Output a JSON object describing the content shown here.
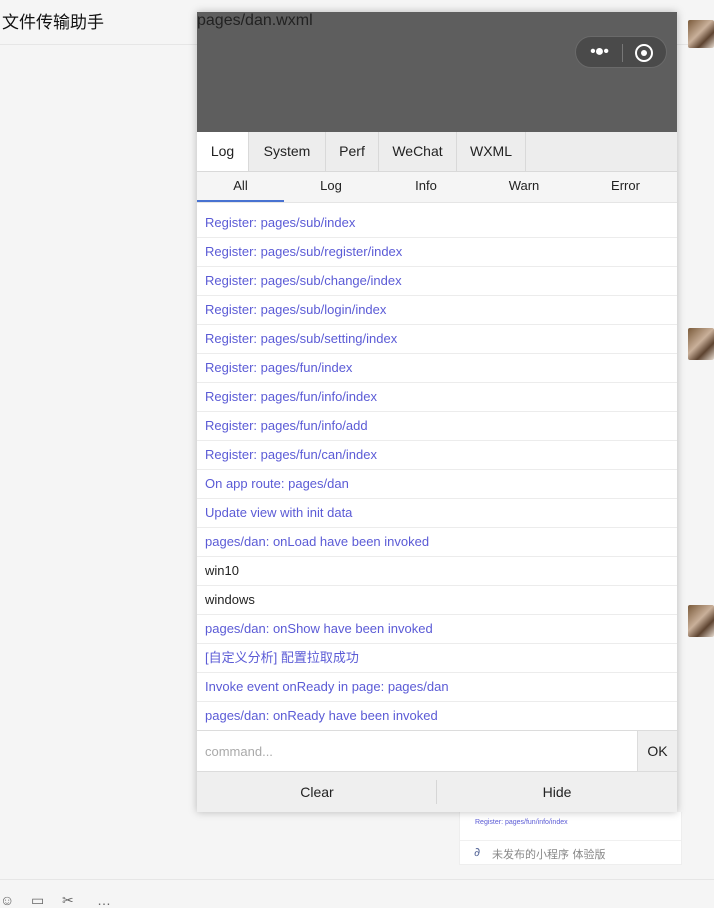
{
  "chat": {
    "title": "文件传输助手",
    "card_register": "Register: pages/fun/info/index",
    "card_footer": "未发布的小程序 体验版"
  },
  "panel": {
    "page_path": "pages/dan.wxml",
    "tabs": [
      {
        "label": "Log"
      },
      {
        "label": "System"
      },
      {
        "label": "Perf"
      },
      {
        "label": "WeChat"
      },
      {
        "label": "WXML"
      }
    ],
    "filters": [
      {
        "label": "All"
      },
      {
        "label": "Log"
      },
      {
        "label": "Info"
      },
      {
        "label": "Warn"
      },
      {
        "label": "Error"
      }
    ],
    "logs": [
      {
        "text": "Register: pages/sub/index"
      },
      {
        "text": "Register: pages/sub/register/index"
      },
      {
        "text": "Register: pages/sub/change/index"
      },
      {
        "text": "Register: pages/sub/login/index"
      },
      {
        "text": "Register: pages/sub/setting/index"
      },
      {
        "text": "Register: pages/fun/index"
      },
      {
        "text": "Register: pages/fun/info/index"
      },
      {
        "text": "Register: pages/fun/info/add"
      },
      {
        "text": "Register: pages/fun/can/index"
      },
      {
        "text": "On app route: pages/dan"
      },
      {
        "text": "Update view with init data"
      },
      {
        "text": "pages/dan: onLoad have been invoked"
      },
      {
        "text": "win10"
      },
      {
        "text": "windows"
      },
      {
        "text": "pages/dan: onShow have been invoked"
      },
      {
        "text": "[自定义分析] 配置拉取成功"
      },
      {
        "text": "Invoke event onReady in page: pages/dan"
      },
      {
        "text": "pages/dan: onReady have been invoked"
      }
    ],
    "command": {
      "placeholder": "command...",
      "ok_label": "OK"
    },
    "footer": {
      "clear_label": "Clear",
      "hide_label": "Hide"
    }
  }
}
